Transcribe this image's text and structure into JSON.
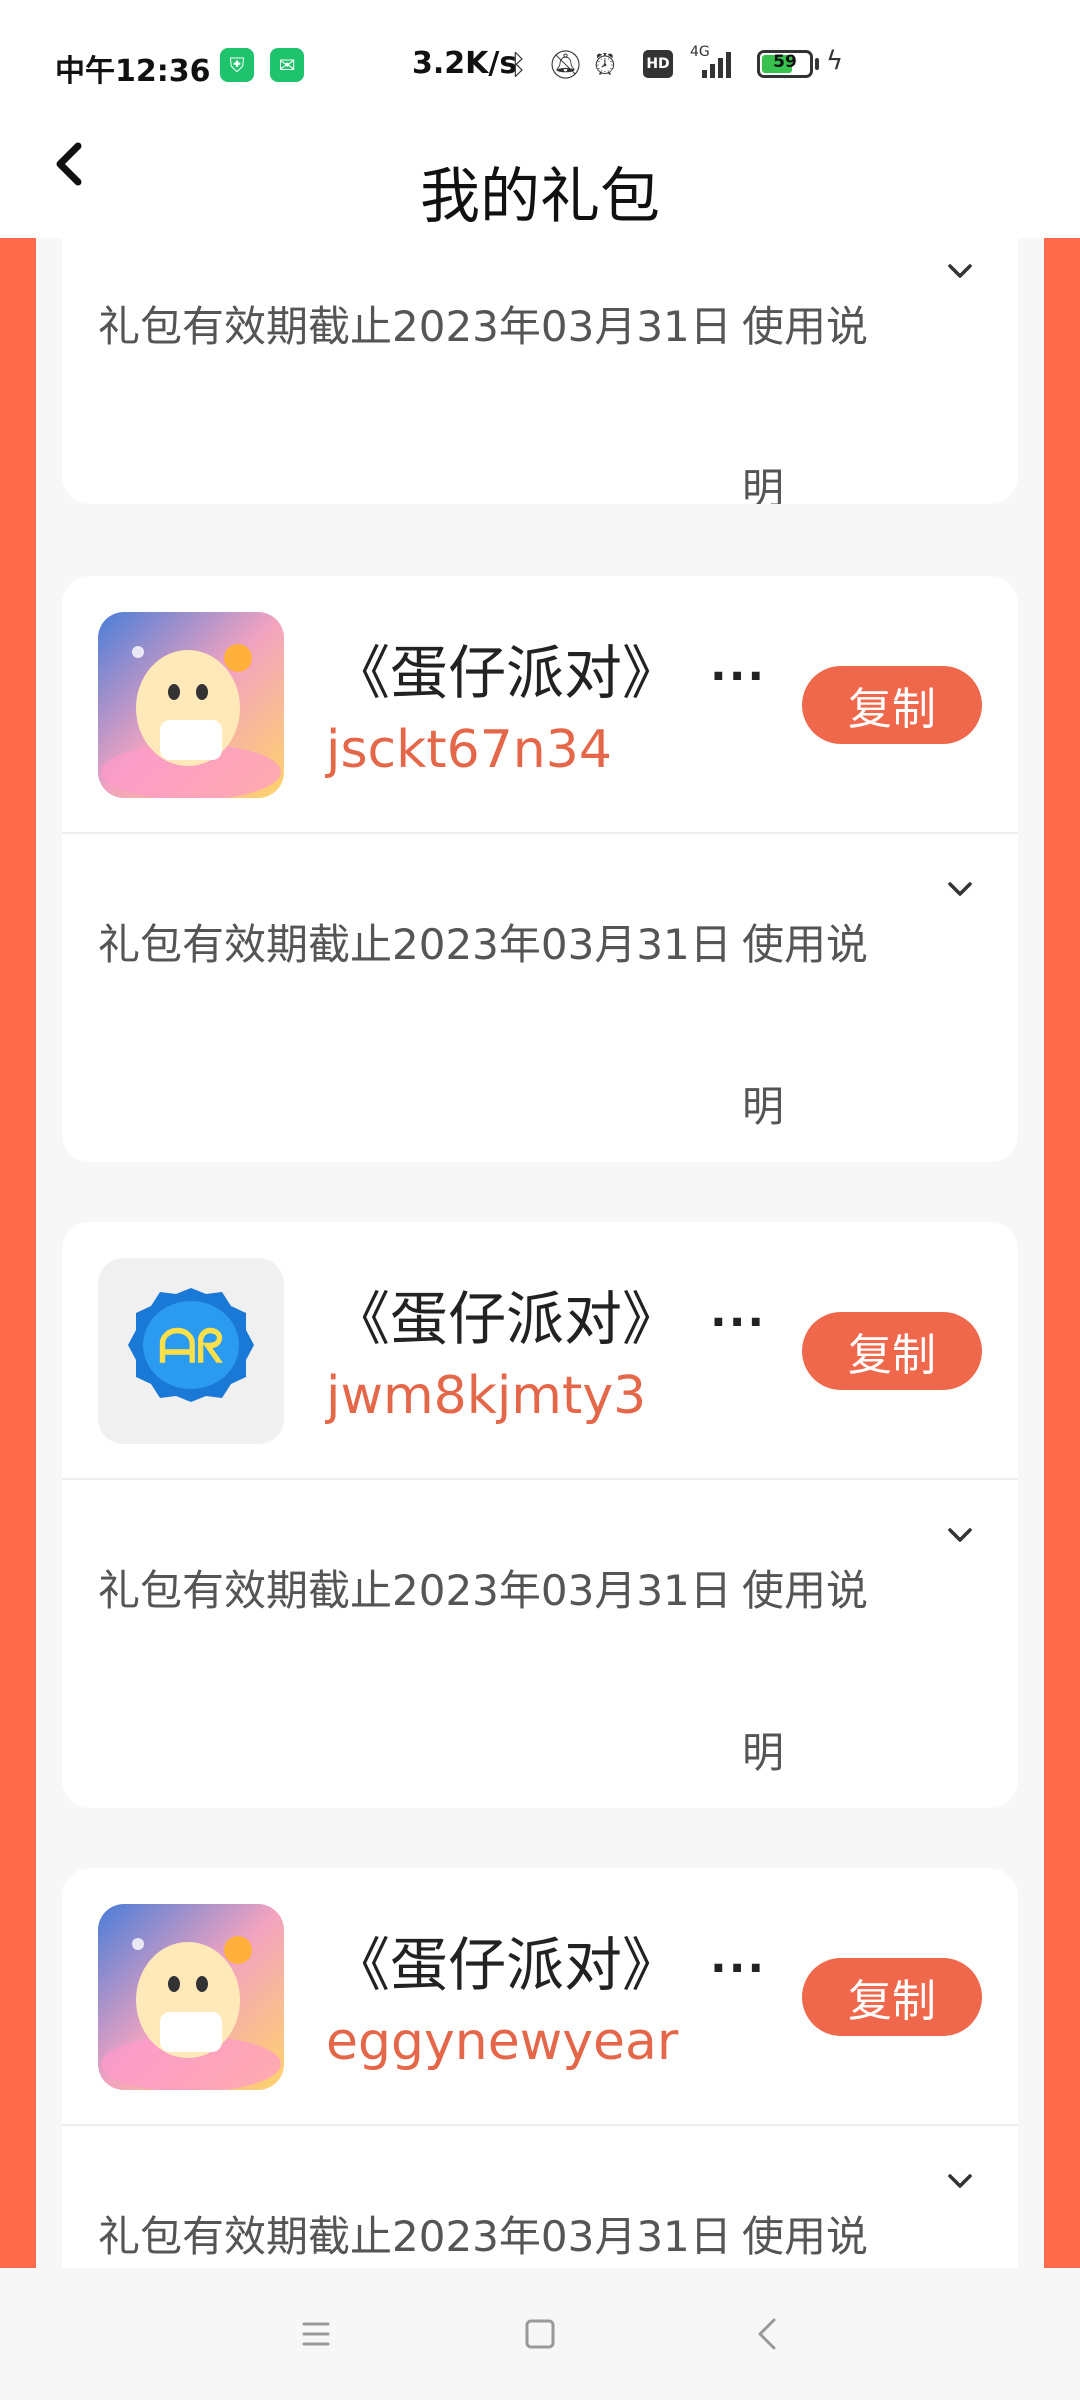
{
  "status_bar": {
    "time": "中午12:36",
    "net_speed": "3.2K/s",
    "signal_label": "4G",
    "hd_label": "HD",
    "battery_level": "59",
    "icons": [
      "shield-app-icon",
      "wechat-icon",
      "bluetooth-icon",
      "mute-bell-icon",
      "alarm-icon",
      "hd-icon",
      "signal-icon",
      "battery-icon",
      "charging-icon"
    ]
  },
  "header": {
    "title": "我的礼包",
    "back_icon": "chevron-left-icon"
  },
  "gifts": [
    {
      "validity": "礼包有效期截止2023年03月31日",
      "usage_label": "使用说明"
    },
    {
      "name": "《蛋仔派对》",
      "ellipsis": "...",
      "code": "jsckt67n34",
      "copy_label": "复制",
      "icon": "eggy-party-icon",
      "validity": "礼包有效期截止2023年03月31日",
      "usage_label": "使用说明"
    },
    {
      "name": "《蛋仔派对》",
      "ellipsis": "...",
      "code": "jwm8kjmty3",
      "copy_label": "复制",
      "icon": "bottle-cap-icon",
      "validity": "礼包有效期截止2023年03月31日",
      "usage_label": "使用说明"
    },
    {
      "name": "《蛋仔派对》",
      "ellipsis": "...",
      "code": "eggynewyear",
      "copy_label": "复制",
      "icon": "eggy-party-icon",
      "validity": "礼包有效期截止2023年03月31日",
      "usage_label": "使用说明"
    }
  ],
  "colors": {
    "accent": "#f0684b",
    "stage": "#ff6b4a",
    "code_text": "#e5674a"
  },
  "nav_bar": [
    "menu-icon",
    "home-icon",
    "back-icon"
  ]
}
